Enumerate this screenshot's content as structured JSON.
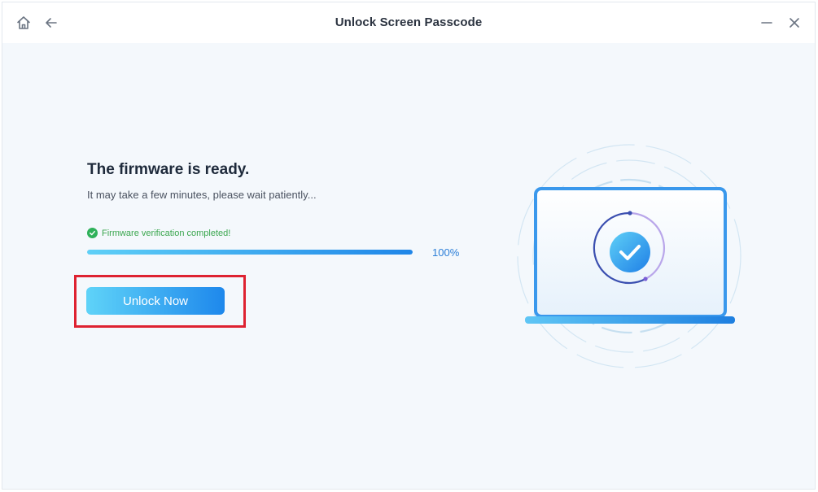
{
  "window": {
    "title": "Unlock Screen Passcode"
  },
  "titlebar": {
    "home_icon": "home-icon",
    "back_icon": "arrow-left-icon",
    "minimize_icon": "minimize-icon",
    "close_icon": "close-icon"
  },
  "main": {
    "heading": "The firmware is ready.",
    "subtext": "It may take a few minutes, please wait patiently...",
    "status_text": "Firmware verification completed!",
    "progress": {
      "percent_label": "100%",
      "value": 1.0
    },
    "unlock_button_label": "Unlock Now"
  },
  "colors": {
    "accent_blue": "#1e88ec",
    "accent_cyan": "#5fd3f8",
    "success_green": "#2fb15a",
    "highlight_red": "#de2231"
  }
}
